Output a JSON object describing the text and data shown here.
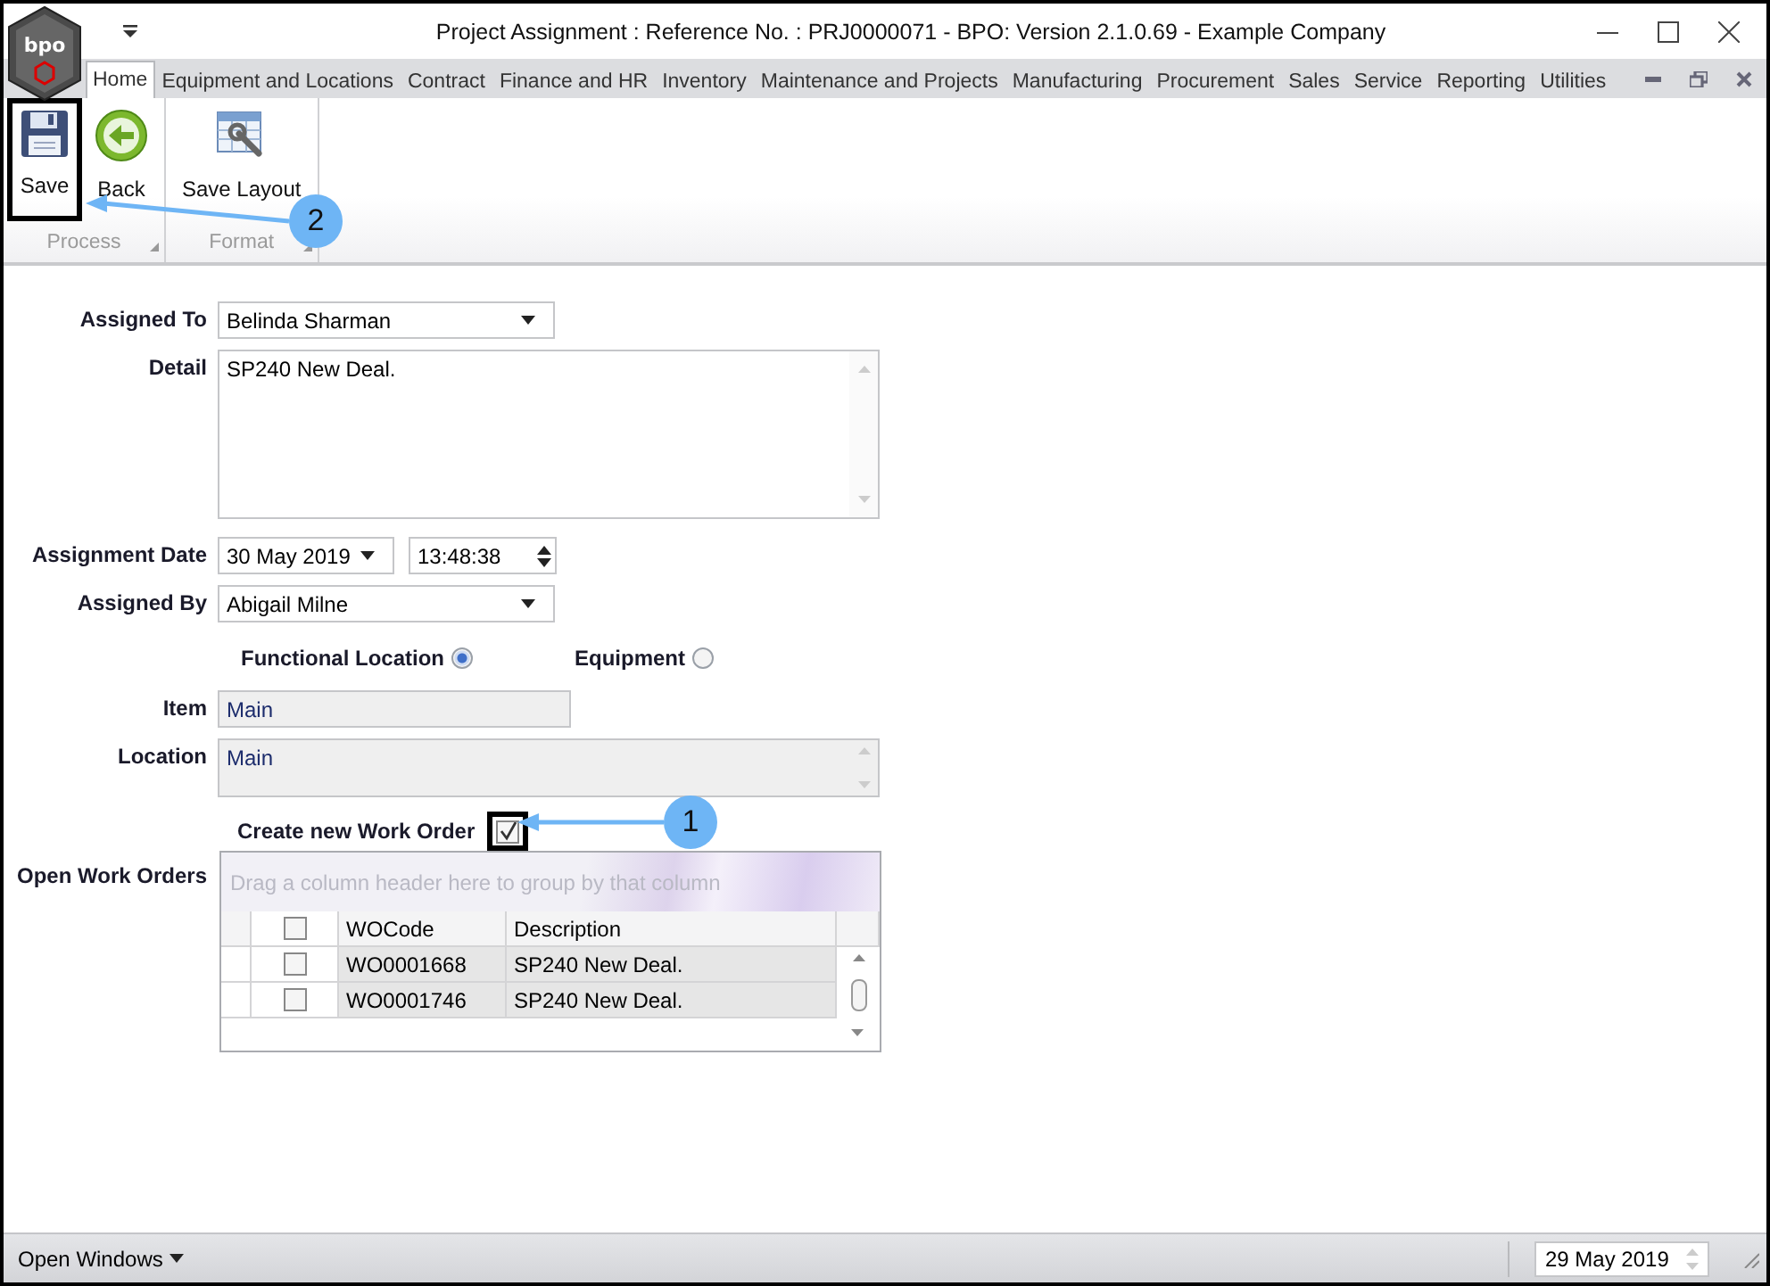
{
  "window": {
    "logo_text": "bpo",
    "title": "Project Assignment : Reference No. : PRJ0000071 - BPO: Version 2.1.0.69 - Example Company"
  },
  "tabs": [
    {
      "label": "Home",
      "selected": true
    },
    {
      "label": "Equipment and Locations",
      "selected": false
    },
    {
      "label": "Contract",
      "selected": false
    },
    {
      "label": "Finance and HR",
      "selected": false
    },
    {
      "label": "Inventory",
      "selected": false
    },
    {
      "label": "Maintenance and Projects",
      "selected": false
    },
    {
      "label": "Manufacturing",
      "selected": false
    },
    {
      "label": "Procurement",
      "selected": false
    },
    {
      "label": "Sales",
      "selected": false
    },
    {
      "label": "Service",
      "selected": false
    },
    {
      "label": "Reporting",
      "selected": false
    },
    {
      "label": "Utilities",
      "selected": false
    }
  ],
  "ribbon": {
    "groups": [
      {
        "label": "Process",
        "buttons": [
          {
            "label": "Save",
            "kind": "save",
            "highlighted": true
          },
          {
            "label": "Back",
            "kind": "back",
            "highlighted": false
          }
        ]
      },
      {
        "label": "Format",
        "buttons": [
          {
            "label": "Save Layout",
            "kind": "layout",
            "highlighted": false
          }
        ]
      }
    ]
  },
  "form": {
    "assigned_to": {
      "label": "Assigned To",
      "value": "Belinda Sharman"
    },
    "detail": {
      "label": "Detail",
      "value": "SP240 New Deal."
    },
    "assignment_date": {
      "label": "Assignment Date",
      "date": "30 May 2019",
      "time": "13:48:38"
    },
    "assigned_by": {
      "label": "Assigned By",
      "value": "Abigail Milne"
    },
    "location_type": [
      {
        "label": "Functional Location",
        "selected": true
      },
      {
        "label": "Equipment",
        "selected": false
      }
    ],
    "item": {
      "label": "Item",
      "value": "Main"
    },
    "location": {
      "label": "Location",
      "value": "Main"
    },
    "create_work_order": {
      "label": "Create new Work Order",
      "checked": true,
      "highlighted": true
    },
    "open_work_orders": {
      "label": "Open Work Orders",
      "group_hint": "Drag a column header here to group by that column",
      "columns": [
        "WOCode",
        "Description"
      ],
      "header_checked": false,
      "rows": [
        {
          "checked": false,
          "wo_code": "WO0001668",
          "description": "SP240 New Deal."
        },
        {
          "checked": false,
          "wo_code": "WO0001746",
          "description": "SP240 New Deal."
        }
      ]
    }
  },
  "callouts": [
    {
      "number": "1"
    },
    {
      "number": "2"
    }
  ],
  "status_bar": {
    "open_windows": "Open Windows",
    "date": "29 May 2019"
  }
}
